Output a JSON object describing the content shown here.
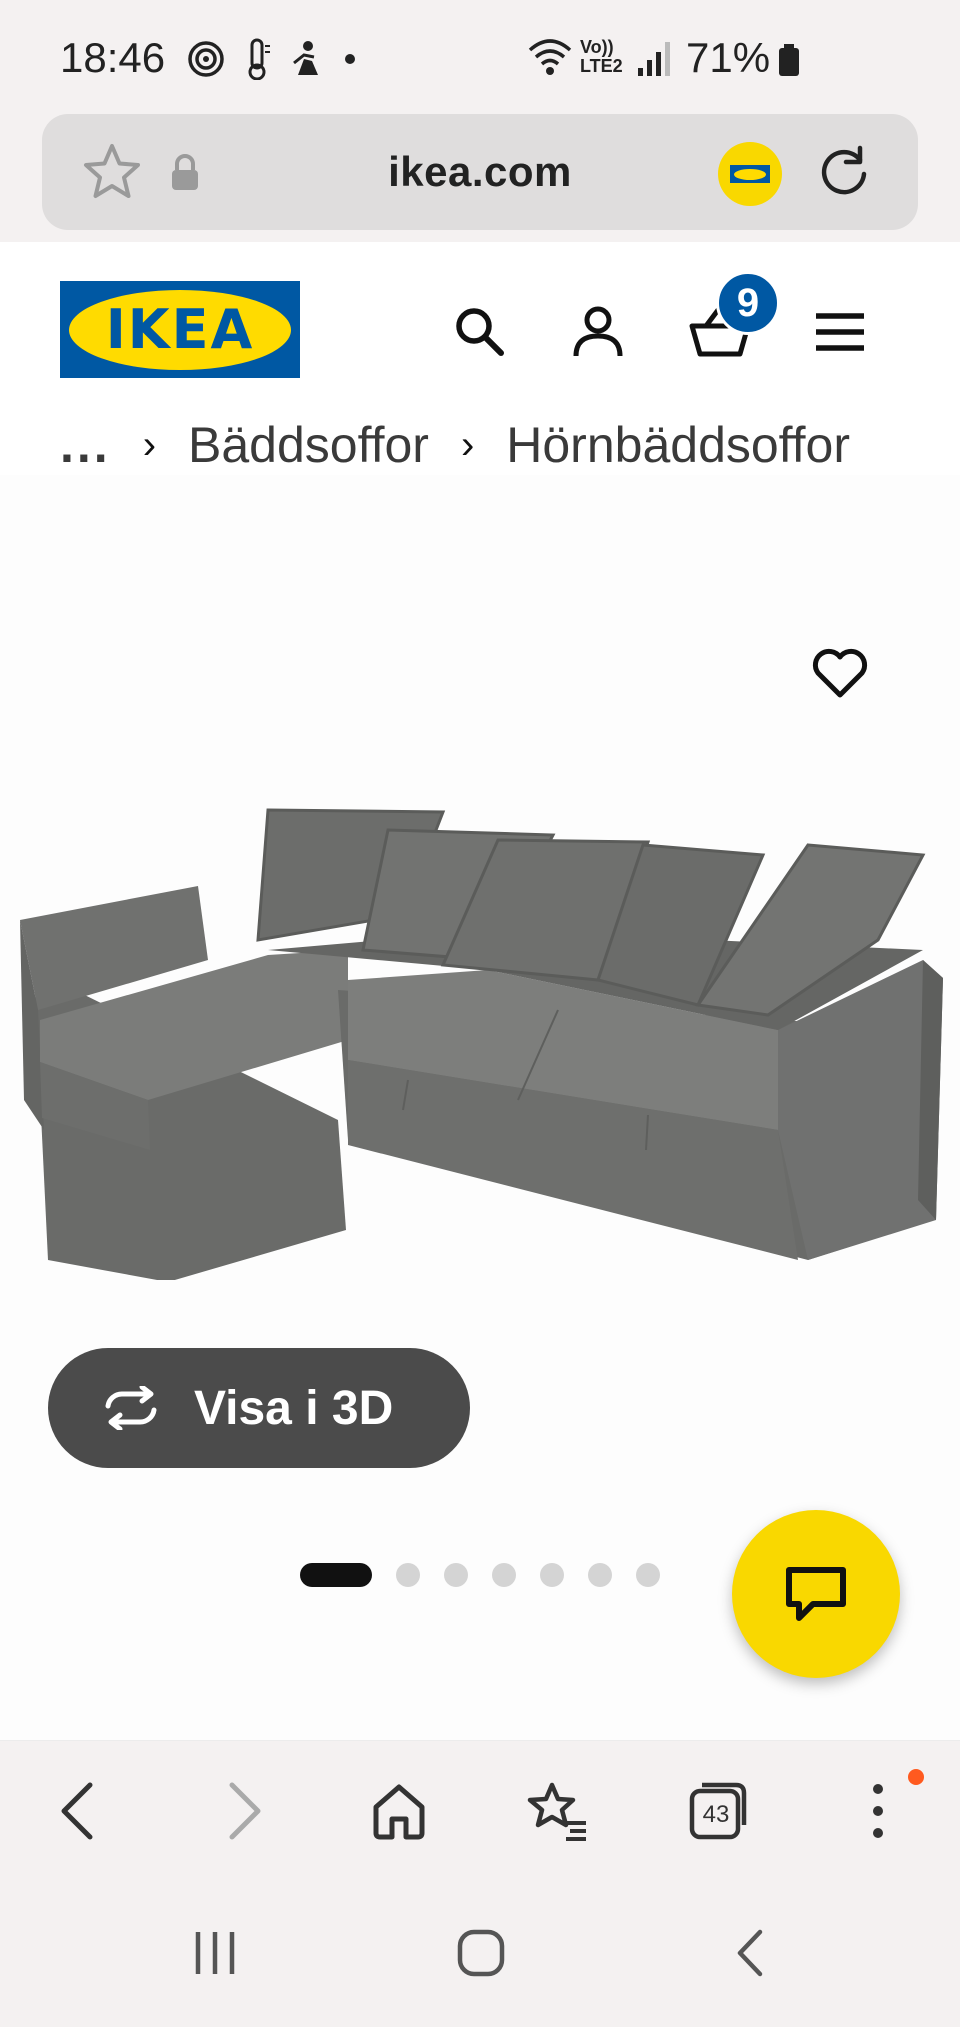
{
  "status_bar": {
    "time": "18:46",
    "network": "Vo)) LTE2",
    "battery": "71%"
  },
  "browser": {
    "url": "ikea.com",
    "tab_count": "43"
  },
  "site": {
    "logo_text": "IKEA",
    "cart_count": "9"
  },
  "breadcrumb": {
    "ellipsis": "...",
    "items": [
      "Bäddsoffor",
      "Hörnbäddsoffor"
    ]
  },
  "product": {
    "view_3d_label": "Visa i 3D",
    "image_count": 7,
    "active_image": 1
  },
  "colors": {
    "ikea_blue": "#0058a3",
    "ikea_yellow": "#ffdb00",
    "chat_yellow": "#f9d800",
    "pill_gray": "#4b4b4b"
  }
}
